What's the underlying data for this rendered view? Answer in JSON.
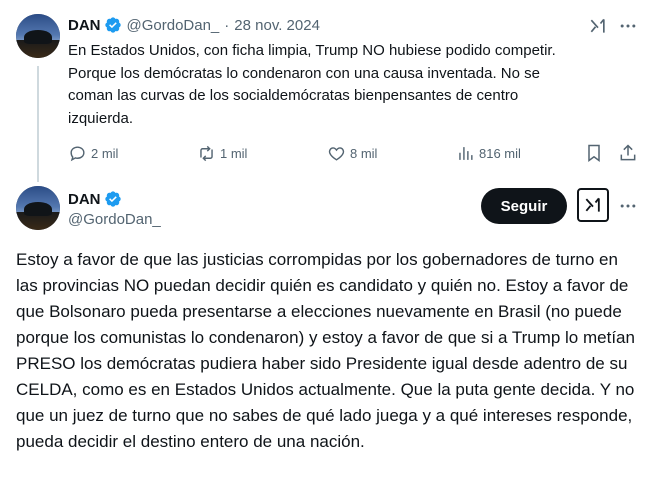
{
  "tweet1": {
    "name": "DAN",
    "handle": "@GordoDan_",
    "separator": "·",
    "date": "28 nov. 2024",
    "lines": [
      "En Estados Unidos, con ficha limpia, Trump NO hubiese podido competir.",
      "Porque los demócratas lo condenaron con una causa inventada. No se",
      "coman las curvas de los socialdemócratas bienpensantes de centro",
      "izquierda."
    ],
    "replies": "2 mil",
    "reposts": "1 mil",
    "likes": "8 mil",
    "views": "816 mil"
  },
  "tweet2": {
    "name": "DAN",
    "handle": "@GordoDan_",
    "follow_label": "Seguir",
    "text": "Estoy a favor de que las justicias corrompidas por los gobernadores de turno en las provincias NO puedan decidir quién es candidato y quién no. Estoy a favor de que Bolsonaro pueda presentarse a elecciones nuevamente en Brasil (no puede porque los comunistas lo condenaron) y estoy a favor de que si a Trump lo metían PRESO los demócratas pudiera haber sido Presidente igual desde adentro de su CELDA, como es en Estados Unidos actualmente. Que la puta gente decida. Y no que un juez de turno que no sabes de qué lado juega y a qué intereses responde, pueda decidir el destino entero de una nación."
  },
  "colors": {
    "text": "#0f1419",
    "muted": "#536471",
    "verified": "#1d9bf0",
    "thread_line": "#cfd9de",
    "follow_bg": "#0f1419"
  },
  "icons": [
    "verified-badge-icon",
    "grok-icon",
    "more-icon",
    "reply-icon",
    "repost-icon",
    "like-icon",
    "views-icon",
    "bookmark-icon",
    "share-icon"
  ]
}
